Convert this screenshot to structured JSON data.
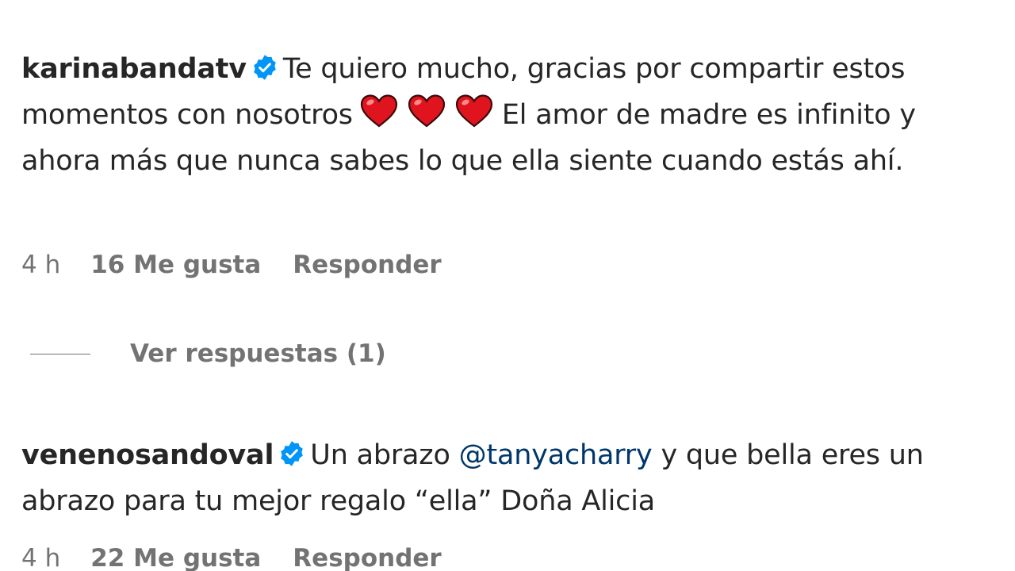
{
  "comments": [
    {
      "username": "karinabandatv",
      "verified": true,
      "text_before": "Te quiero mucho, gracias por compartir estos momentos con nosotros",
      "hearts": 3,
      "text_after": "El amor de madre es infinito y ahora más que nunca sabes lo que ella siente cuando estás ahí.",
      "time": "4 h",
      "likes": "16 Me gusta",
      "reply": "Responder",
      "view_replies": "Ver respuestas (1)"
    },
    {
      "username": "venenosandoval",
      "verified": true,
      "text_before": "Un abrazo",
      "mention": "@tanyacharry",
      "text_after": "y que bella eres un abrazo para tu mejor regalo “ella” Doña Alicia",
      "time": "4 h",
      "likes": "22 Me gusta",
      "reply": "Responder"
    }
  ],
  "colors": {
    "text": "#262626",
    "secondary": "#737373",
    "verified_badge": "#0095f6",
    "mention": "#00376b",
    "heart": "#e0141e"
  },
  "icons": {
    "verified": "verified-badge-icon",
    "heart": "red-heart-emoji"
  }
}
